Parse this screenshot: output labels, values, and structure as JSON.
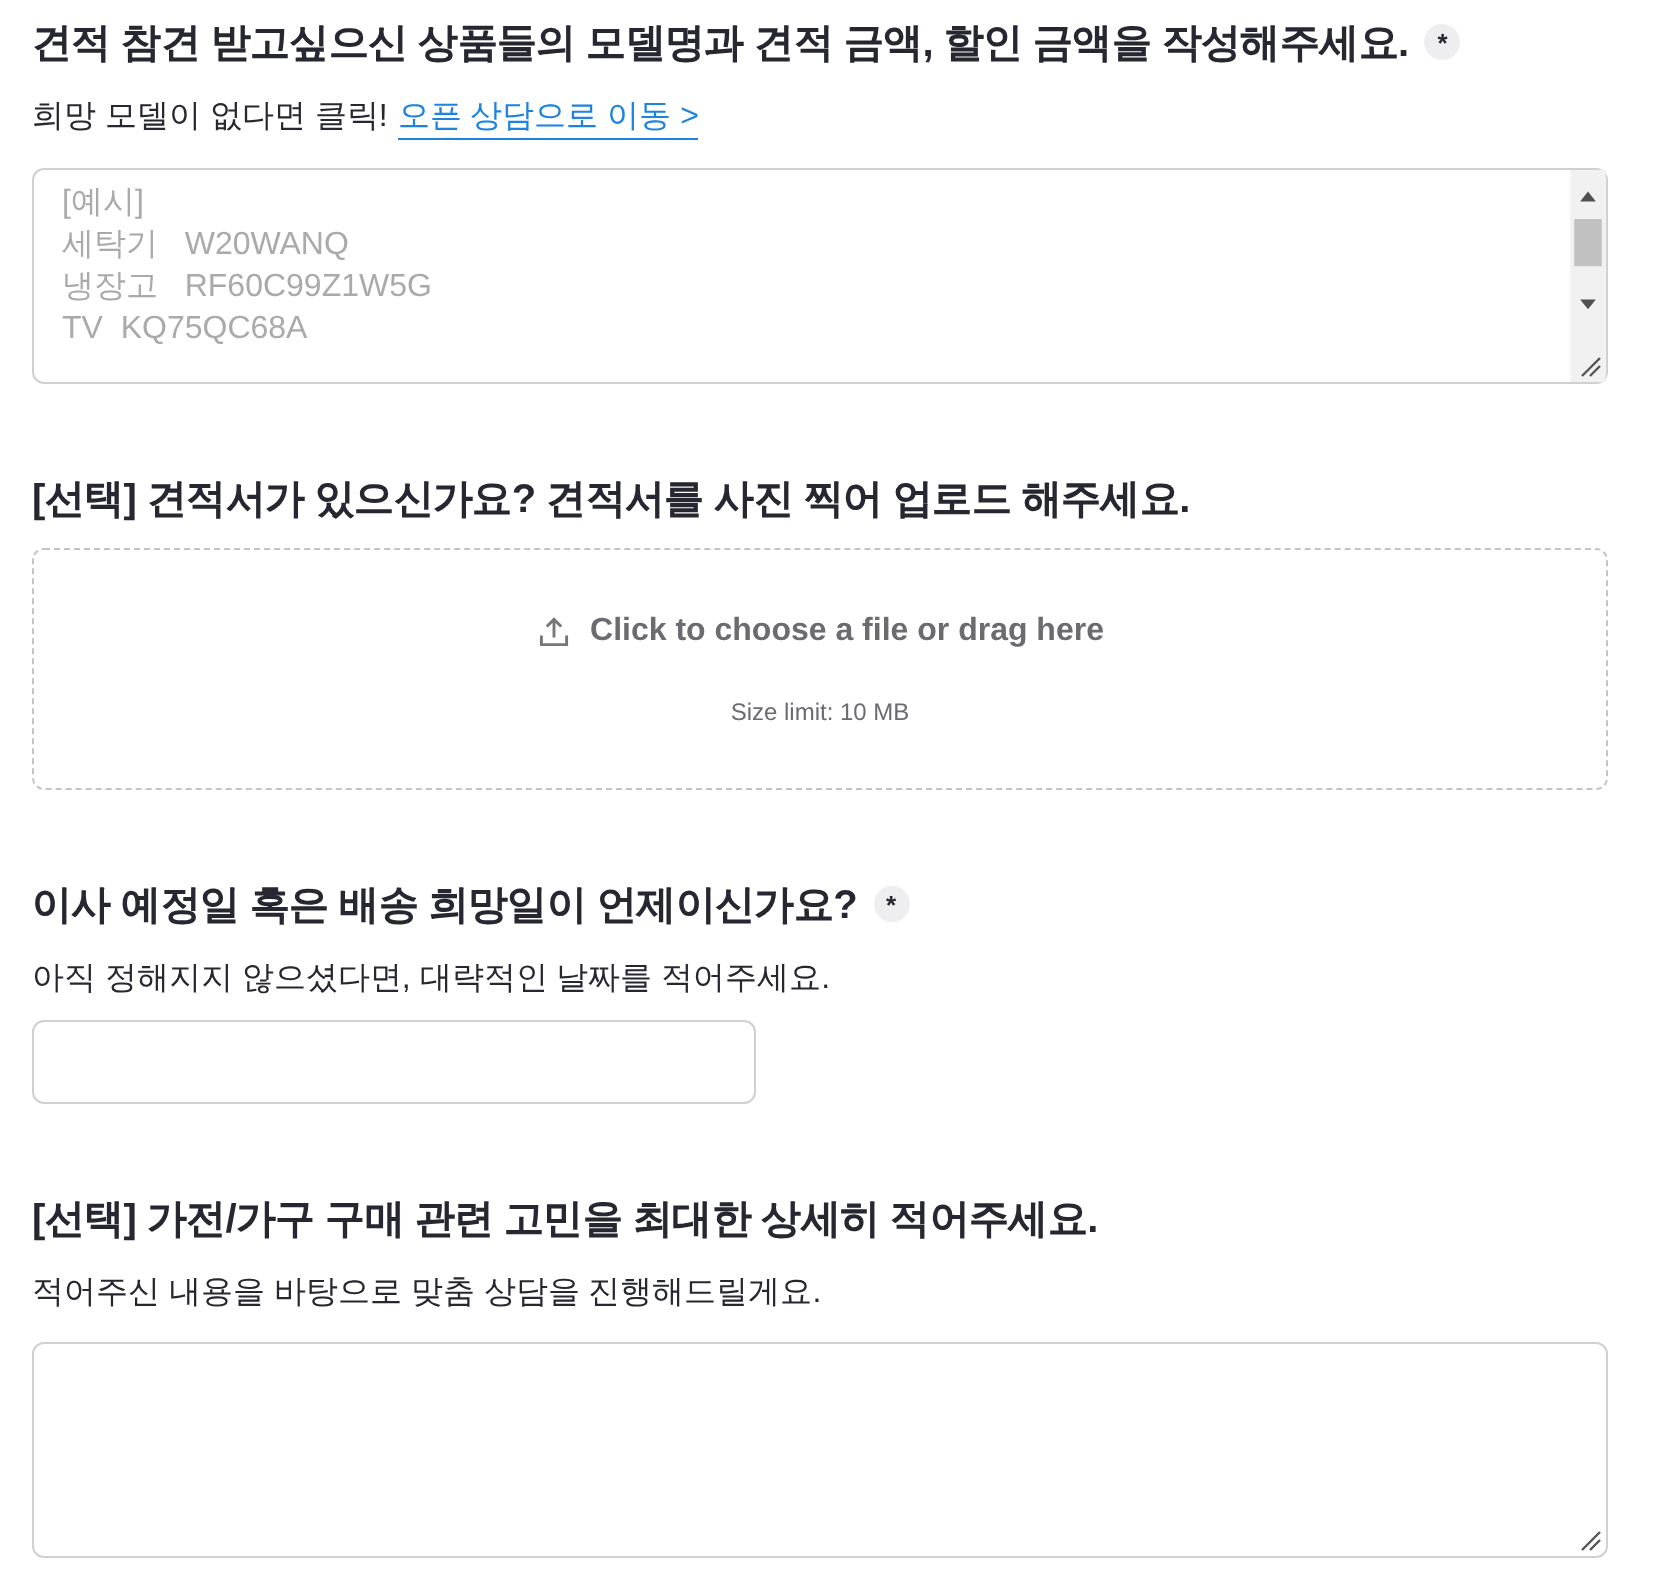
{
  "questions": [
    {
      "kind": "textarea",
      "title": "견적 참견 받고싶으신 상품들의 모델명과 견적 금액, 할인 금액을 작성해주세요.",
      "required_mark": "*",
      "description": "희망 모델이 없다면 클릭!",
      "link": "오픈 상담으로 이동 >",
      "placeholder": "[예시]\n세탁기   W20WANQ\n냉장고   RF60C99Z1W5G\nTV  KQ75QC68A"
    },
    {
      "kind": "upload",
      "title": "[선택] 견적서가 있으신가요? 견적서를 사진 찍어 업로드 해주세요.",
      "prompt": "Click to choose a file or drag here",
      "limit": "Size limit: 10 MB"
    },
    {
      "kind": "input",
      "title": "이사 예정일 혹은 배송 희망일이 언제이신가요?",
      "required_mark": "*",
      "description": "아직 정해지지 않으셨다면, 대략적인 날짜를 적어주세요."
    },
    {
      "kind": "textarea",
      "title": "[선택] 가전/가구 구매 관련 고민을 최대한 상세히 적어주세요.",
      "description": "적어주신 내용을 바탕으로 맞춤 상담을 진행해드릴게요."
    }
  ]
}
